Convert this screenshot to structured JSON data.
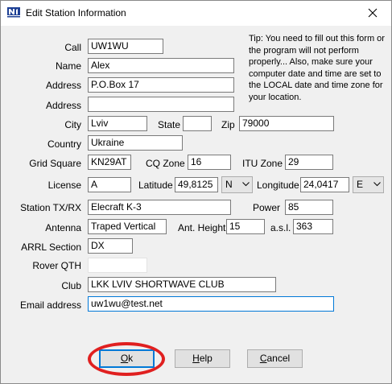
{
  "window": {
    "title": "Edit Station Information",
    "close_glyph": "✕",
    "icon": "n1mm-app-icon"
  },
  "tip": "Tip: You need to fill out this form or the program will not perform properly... Also, make sure your computer date and time are set to the LOCAL date and time zone for your location.",
  "labels": {
    "call": "Call",
    "name": "Name",
    "address": "Address",
    "address2": "Address",
    "city": "City",
    "state": "State",
    "zip": "Zip",
    "country": "Country",
    "grid_square": "Grid Square",
    "cq_zone": "CQ Zone",
    "itu_zone": "ITU Zone",
    "license": "License",
    "latitude": "Latitude",
    "longitude": "Longitude",
    "station": "Station TX/RX",
    "power": "Power",
    "antenna": "Antenna",
    "ant_height": "Ant. Height",
    "asl": "a.s.l.",
    "arrl_section": "ARRL Section",
    "rover_qth": "Rover QTH",
    "club": "Club",
    "email": "Email address"
  },
  "fields": {
    "call": "UW1WU",
    "name": "Alex",
    "address": "P.O.Box 17",
    "address2": "",
    "city": "Lviv",
    "state": "",
    "zip": "79000",
    "country": "Ukraine",
    "grid_square": "KN29AT",
    "cq_zone": "16",
    "itu_zone": "29",
    "license": "A",
    "latitude": "49,8125",
    "lat_dir": "N",
    "longitude": "24,0417",
    "lon_dir": "E",
    "station": "Elecraft K-3",
    "power": "85",
    "antenna": "Traped Vertical",
    "ant_height": "15",
    "asl": "363",
    "arrl_section": "DX",
    "rover_qth": "",
    "club": "LKK LVIV SHORTWAVE CLUB",
    "email": "uw1wu@test.net"
  },
  "buttons": {
    "ok_prefix": "",
    "ok_mnemonic": "O",
    "ok_rest": "k",
    "help_mnemonic": "H",
    "help_rest": "elp",
    "cancel_mnemonic": "C",
    "cancel_rest": "ancel"
  },
  "colors": {
    "dialog_bg": "#f0f0f0",
    "focus_border": "#0078d7",
    "annotation_ellipse": "#e02020"
  }
}
